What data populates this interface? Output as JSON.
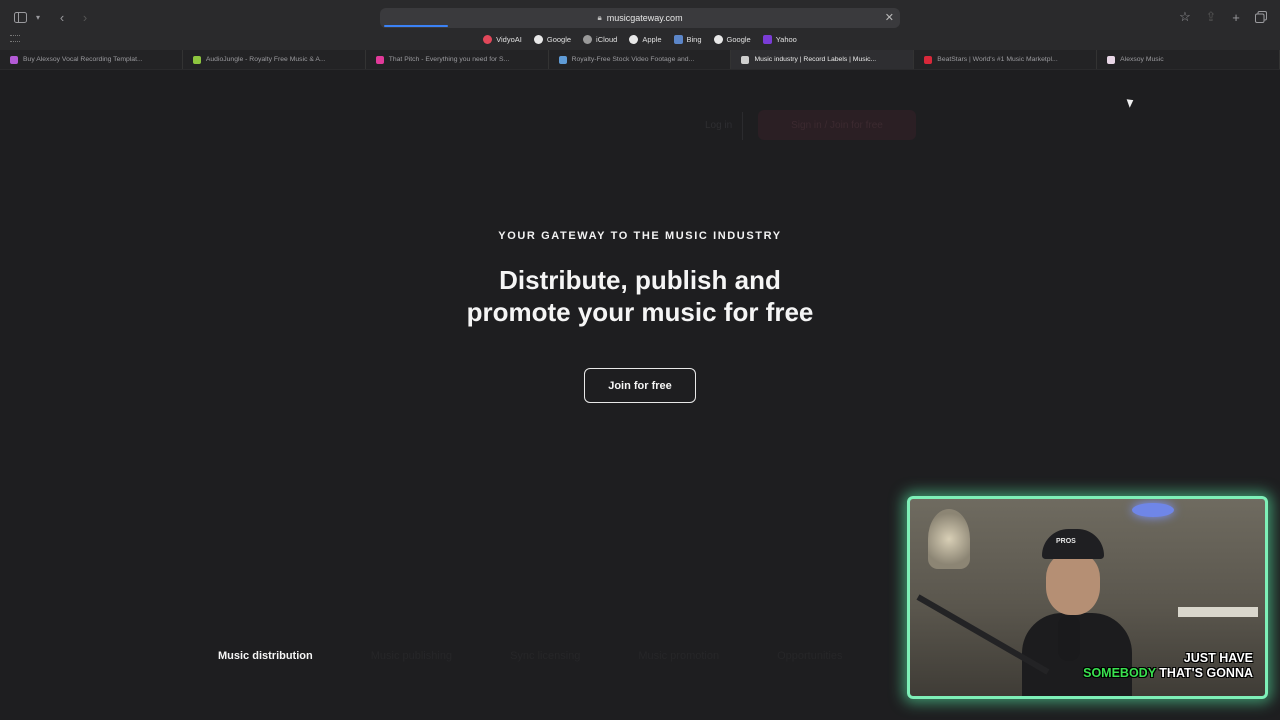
{
  "browser": {
    "url": "musicgateway.com",
    "favorites": [
      {
        "label": "VidyoAI",
        "color": "#e2485a"
      },
      {
        "label": "Google",
        "color": "#e8e8e8"
      },
      {
        "label": "iCloud",
        "color": "#9a9a9a"
      },
      {
        "label": "Apple",
        "color": "#e8e8e8"
      },
      {
        "label": "Bing",
        "color": "#5c86c9"
      },
      {
        "label": "Google",
        "color": "#e8e8e8"
      },
      {
        "label": "Yahoo",
        "color": "#7a3cd6"
      }
    ],
    "tabs": [
      {
        "label": "Buy Alexsoy Vocal Recording Templat...",
        "color": "#b35ad6"
      },
      {
        "label": "AudioJungle - Royalty Free Music & A...",
        "color": "#8ec63f"
      },
      {
        "label": "That Pitch - Everything you need for S...",
        "color": "#e23a9a"
      },
      {
        "label": "Royalty-Free Stock Video Footage and...",
        "color": "#5f9bd6"
      },
      {
        "label": "Music industry | Record Labels | Music...",
        "color": "#cfcfcf",
        "active": true
      },
      {
        "label": "BeatStars | World's #1 Music Marketpl...",
        "color": "#d8283a"
      },
      {
        "label": "Alexsoy Music",
        "color": "#e8d6e6"
      }
    ]
  },
  "page": {
    "header": {
      "login_label": "Log in",
      "cta_label": "Sign in / Join for free"
    },
    "eyebrow": "YOUR GATEWAY TO THE MUSIC INDUSTRY",
    "hero_line1": "Distribute, publish and",
    "hero_line2": "promote your music for free",
    "join_button": "Join for free",
    "subnav": [
      {
        "label": "Music distribution",
        "active": true
      },
      {
        "label": "Music publishing",
        "active": false
      },
      {
        "label": "Sync licensing",
        "active": false
      },
      {
        "label": "Music promotion",
        "active": false
      },
      {
        "label": "Opportunities",
        "active": false
      }
    ]
  },
  "webcam": {
    "cap_text": "PROS",
    "caption_line1": "JUST HAVE",
    "caption_highlight": "SOMEBODY",
    "caption_line2_rest": " THAT'S GONNA",
    "border_color": "#7ef0b8"
  }
}
